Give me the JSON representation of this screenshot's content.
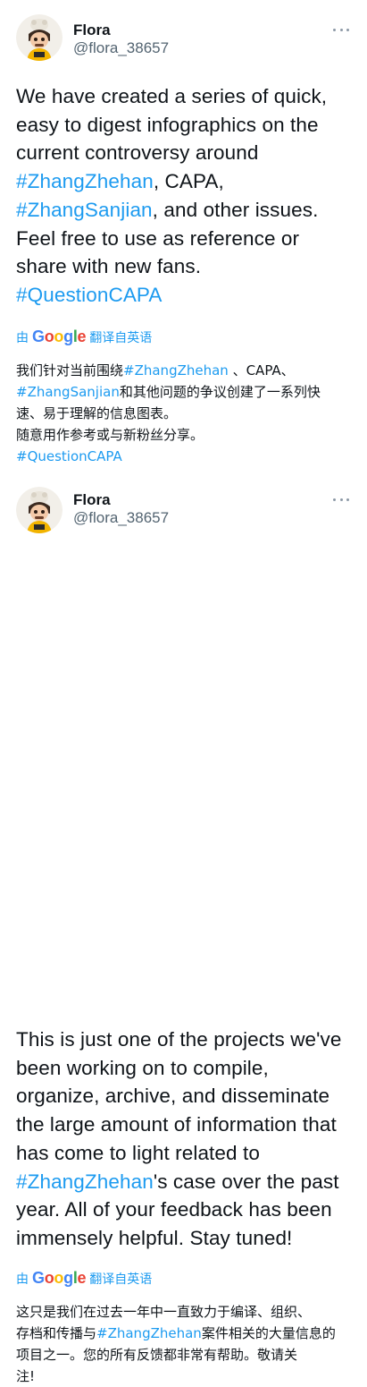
{
  "tweets": [
    {
      "name": "Flora",
      "handle": "@flora_38657",
      "body": [
        {
          "t": "We have created a series of quick,\neasy to digest infographics on the\ncurrent controversy around\n"
        },
        {
          "t": "#ZhangZhehan",
          "tag": true
        },
        {
          "t": ", CAPA,\n"
        },
        {
          "t": "#ZhangSanjian",
          "tag": true
        },
        {
          "t": ", and other issues.\nFeel free to use as reference or\nshare with new fans.\n"
        },
        {
          "t": "#QuestionCAPA",
          "tag": true
        }
      ],
      "translate_prefix": "由",
      "translate_brand": "Google",
      "translate_label": "翻译自英语",
      "translation": [
        {
          "t": "我们针对当前围绕"
        },
        {
          "t": "#ZhangZhehan",
          "tag": true
        },
        {
          "t": " 、CAPA、\n"
        },
        {
          "t": "#ZhangSanjian",
          "tag": true
        },
        {
          "t": "和其他问题的争议创建了一系列快\n速、易于理解的信息图表。\n随意用作参考或与新粉丝分享。\n"
        },
        {
          "t": "#QuestionCAPA",
          "tag": true
        }
      ]
    },
    {
      "name": "Flora",
      "handle": "@flora_38657",
      "body": [
        {
          "t": "This is just one of the projects we've\nbeen working on to compile,\norganize, archive, and disseminate\nthe large amount of information that\nhas come to light related to\n"
        },
        {
          "t": "#ZhangZhehan",
          "tag": true
        },
        {
          "t": "'s case over the past\nyear. All of your feedback has been\nimmensely helpful. Stay tuned!"
        }
      ],
      "translate_prefix": "由",
      "translate_brand": "Google",
      "translate_label": "翻译自英语",
      "translation": [
        {
          "t": "这只是我们在过去一年中一直致力于编译、组织、\n存档和传播与"
        },
        {
          "t": "#ZhangZhehan",
          "tag": true
        },
        {
          "t": "案件相关的大量信息的\n项目之一。您的所有反馈都非常有帮助。敬请关\n注!"
        }
      ]
    }
  ],
  "colors": {
    "accent": "#1d9bf0",
    "text": "#0f1419",
    "muted": "#536471"
  },
  "icons": {
    "more": "more-horizontal-icon",
    "avatar": "cartoon-avatar"
  }
}
